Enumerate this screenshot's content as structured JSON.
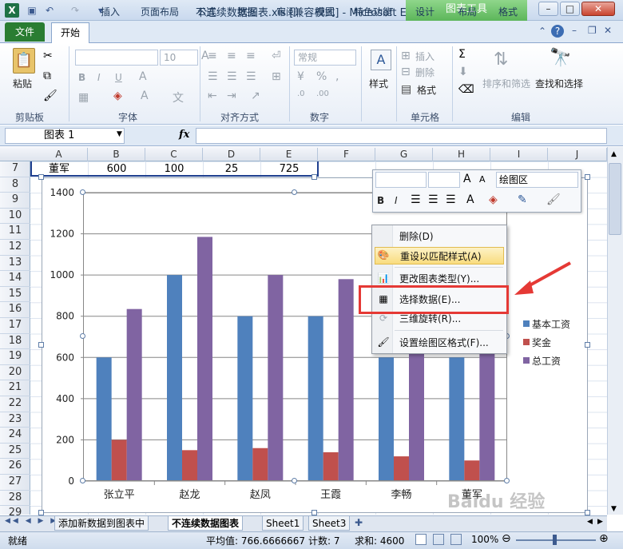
{
  "titlebar": {
    "title": "不连续数据图表.xls  [兼容模式]  -  Microsoft Excel",
    "chart_tools": "图表工具",
    "min": "–",
    "max": "□",
    "close": "✕"
  },
  "ribbon_tabs": [
    "文件",
    "开始",
    "插入",
    "页面布局",
    "公式",
    "数据",
    "审阅",
    "视图",
    "特色功能",
    "设计",
    "布局",
    "格式"
  ],
  "ribbon": {
    "clipboard": {
      "paste": "粘贴",
      "label": "剪贴板"
    },
    "font": {
      "size": "10",
      "label": "字体",
      "bold": "B",
      "italic": "I",
      "underline": "U"
    },
    "alignment": {
      "label": "对齐方式"
    },
    "number": {
      "format": "常规",
      "label": "数字"
    },
    "styles": {
      "label": "样式"
    },
    "cells": {
      "insert": "插入",
      "delete": "删除",
      "format": "格式",
      "label": "单元格"
    },
    "editing": {
      "sort": "排序和筛选",
      "find": "查找和选择",
      "label": "编辑"
    }
  },
  "formula_bar": {
    "name_box": "图表  1",
    "fx": "fx"
  },
  "columns": [
    "A",
    "B",
    "C",
    "D",
    "E",
    "F",
    "G",
    "H",
    "I",
    "J"
  ],
  "rows": [
    "7",
    "8",
    "9",
    "10",
    "11",
    "12",
    "13",
    "14",
    "15",
    "16",
    "17",
    "18",
    "19",
    "20",
    "21",
    "22",
    "23",
    "24",
    "25",
    "26",
    "27",
    "28",
    "29"
  ],
  "row7": [
    "董军",
    "600",
    "100",
    "25",
    "725"
  ],
  "mini_toolbar": {
    "area": "绘图区",
    "bold": "B",
    "italic": "I"
  },
  "context_menu": {
    "items": [
      "删除(D)",
      "重设以匹配样式(A)",
      "更改图表类型(Y)...",
      "选择数据(E)...",
      "三维旋转(R)...",
      "设置绘图区格式(F)..."
    ]
  },
  "sheet_tabs": [
    "添加新数据到图表中",
    "不连续数据图表",
    "Sheet1",
    "Sheet3"
  ],
  "status": {
    "ready": "就绪",
    "average": "平均值: 766.6666667",
    "count": "计数: 7",
    "sum": "求和: 4600",
    "zoom": "100%"
  },
  "watermark": "Baidu 经验",
  "colors": {
    "base": "#4f81bd",
    "bonus": "#c0504d",
    "total": "#8064a2",
    "file_tab": "#2a7d32",
    "chart_tools": "#5cb65a",
    "highlight": "#e53935"
  },
  "chart_data": {
    "type": "bar",
    "categories": [
      "张立平",
      "赵龙",
      "赵凤",
      "王霞",
      "李畅",
      "董军"
    ],
    "series": [
      {
        "name": "基本工资",
        "values": [
          600,
          1000,
          800,
          800,
          600,
          600
        ]
      },
      {
        "name": "奖金",
        "values": [
          200,
          150,
          160,
          140,
          120,
          100
        ]
      },
      {
        "name": "总工资",
        "values": [
          835,
          1185,
          1000,
          980,
          760,
          725
        ]
      }
    ],
    "ylim": [
      0,
      1400
    ],
    "yticks": [
      "0",
      "200",
      "400",
      "600",
      "800",
      "1000",
      "1200",
      "1400"
    ],
    "grid": true,
    "legend": "right"
  }
}
